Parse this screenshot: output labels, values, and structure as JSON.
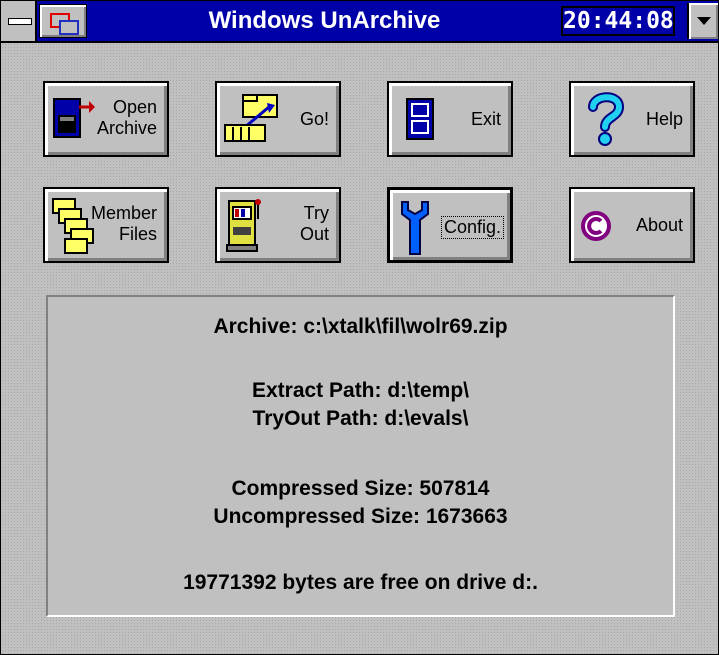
{
  "window": {
    "title": "Windows UnArchive",
    "clock": "20:44:08"
  },
  "buttons": {
    "open_archive": {
      "line1": "Open",
      "line2": "Archive"
    },
    "go": {
      "label": "Go!"
    },
    "exit": {
      "label": "Exit"
    },
    "help": {
      "label": "Help"
    },
    "member_files": {
      "line1": "Member",
      "line2": "Files"
    },
    "try_out": {
      "line1": "Try",
      "line2": "Out"
    },
    "config": {
      "label": "Config."
    },
    "about": {
      "label": "About"
    }
  },
  "info": {
    "archive": "Archive:  c:\\xtalk\\fil\\wolr69.zip",
    "extract_path": "Extract Path:  d:\\temp\\",
    "tryout_path": "TryOut Path:  d:\\evals\\",
    "compressed": "Compressed Size:  507814",
    "uncompressed": "Uncompressed Size:  1673663",
    "free_space": "19771392 bytes are free on drive d:."
  },
  "icons": {
    "open_archive": "cabinet-arrow-icon",
    "go": "hand-folder-icon",
    "exit": "exit-door-icon",
    "help": "question-mark-icon",
    "member_files": "stacked-files-icon",
    "try_out": "slot-machine-icon",
    "config": "wrench-icon",
    "about": "copyright-icon"
  }
}
